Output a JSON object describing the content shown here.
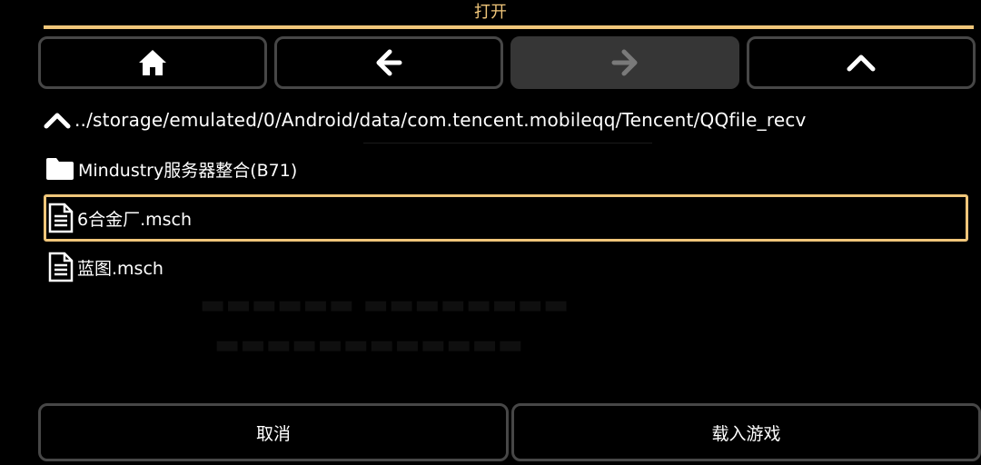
{
  "dialog": {
    "title": "打开"
  },
  "nav": {
    "home_icon": "home-icon",
    "back_icon": "arrow-left-icon",
    "forward_icon": "arrow-right-icon",
    "up_icon": "chevron-up-icon",
    "forward_disabled": true
  },
  "path": {
    "icon": "chevron-up-icon",
    "text": "../storage/emulated/0/Android/data/com.tencent.mobileqq/Tencent/QQfile_recv"
  },
  "files": [
    {
      "icon": "folder-icon",
      "name": "Mindustry服务器整合(B71)",
      "selected": false
    },
    {
      "icon": "file-icon",
      "name": "6合金厂.msch",
      "selected": true
    },
    {
      "icon": "file-icon",
      "name": "蓝图.msch",
      "selected": false
    }
  ],
  "buttons": {
    "cancel": "取消",
    "load": "载入游戏"
  },
  "colors": {
    "accent": "#f0c67a",
    "border": "#474747",
    "disabled": "#363636",
    "background": "#000000"
  }
}
